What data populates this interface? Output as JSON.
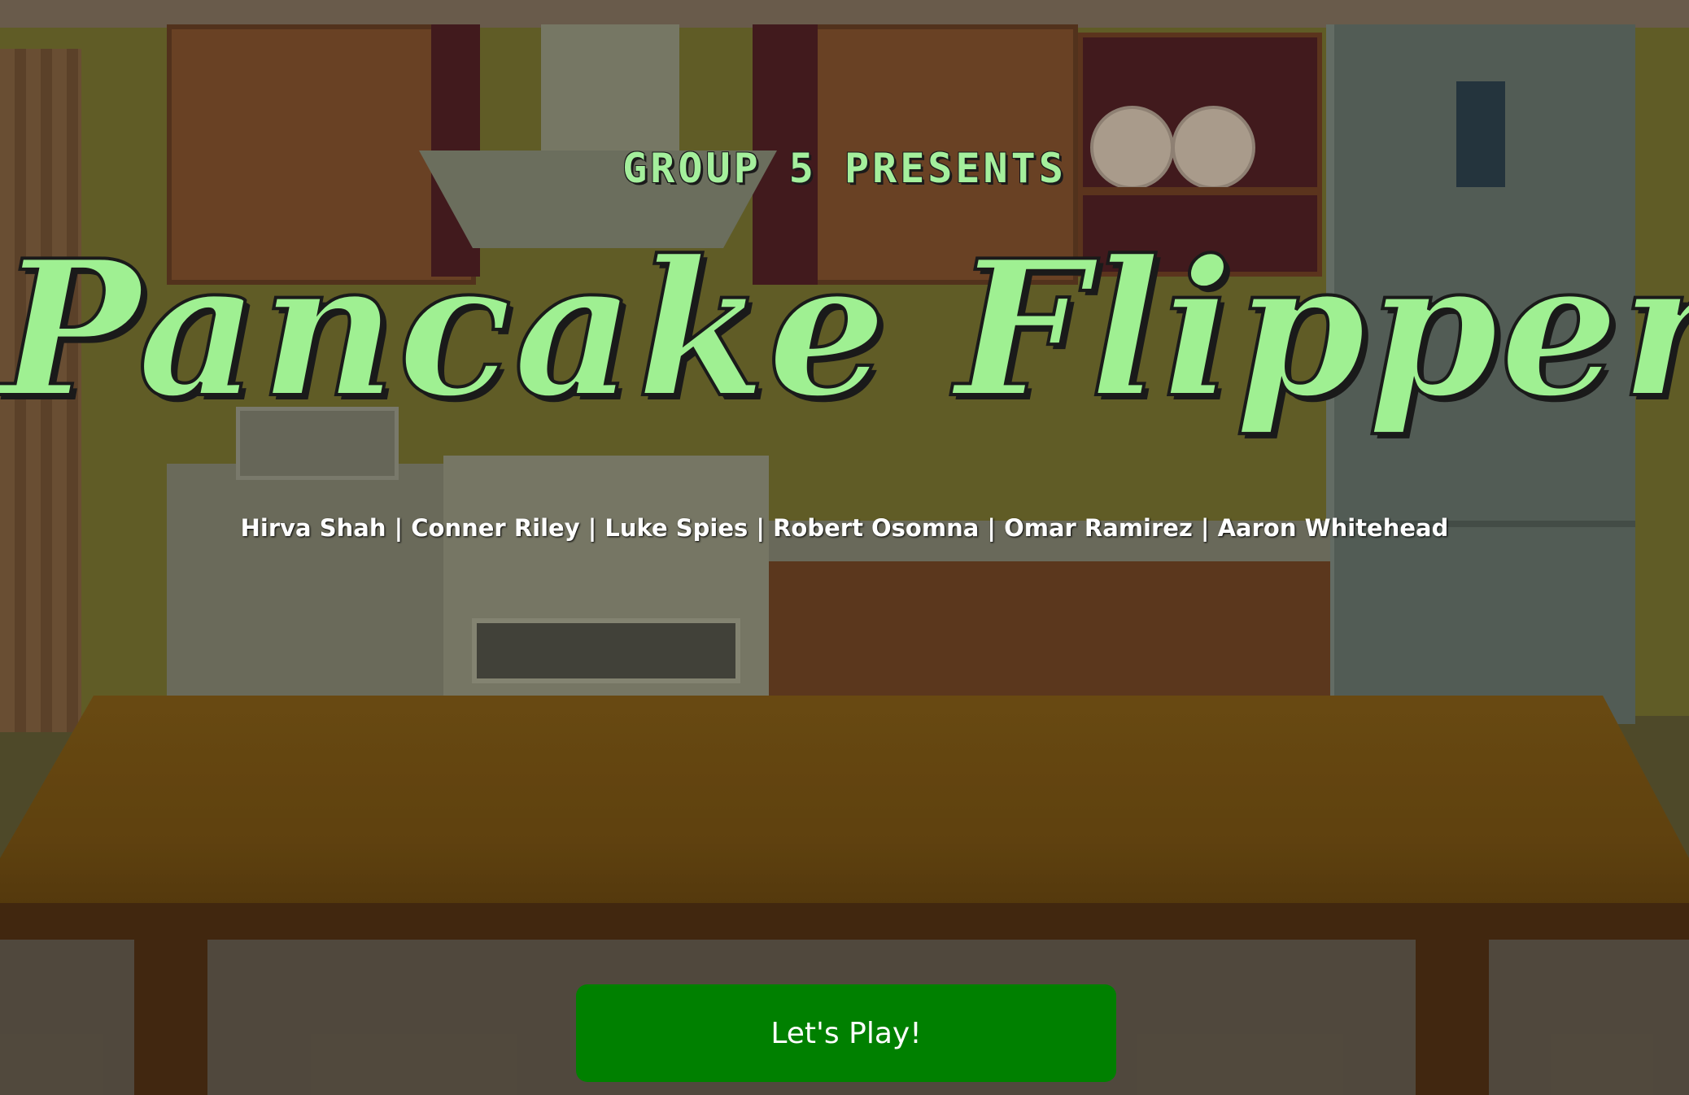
{
  "header": {
    "presenter_text": "GROUP 5 PRESENTS",
    "game_title": "Pancake Flipper"
  },
  "credits": {
    "text": "Hirva Shah | Conner Riley | Luke Spies | Robert Osomna | Omar Ramirez | Aaron Whitehead"
  },
  "actions": {
    "play_label": "Let's Play!"
  },
  "colors": {
    "title_green": "#9ff092",
    "button_green": "#008000",
    "credits_text": "#ffffff"
  }
}
